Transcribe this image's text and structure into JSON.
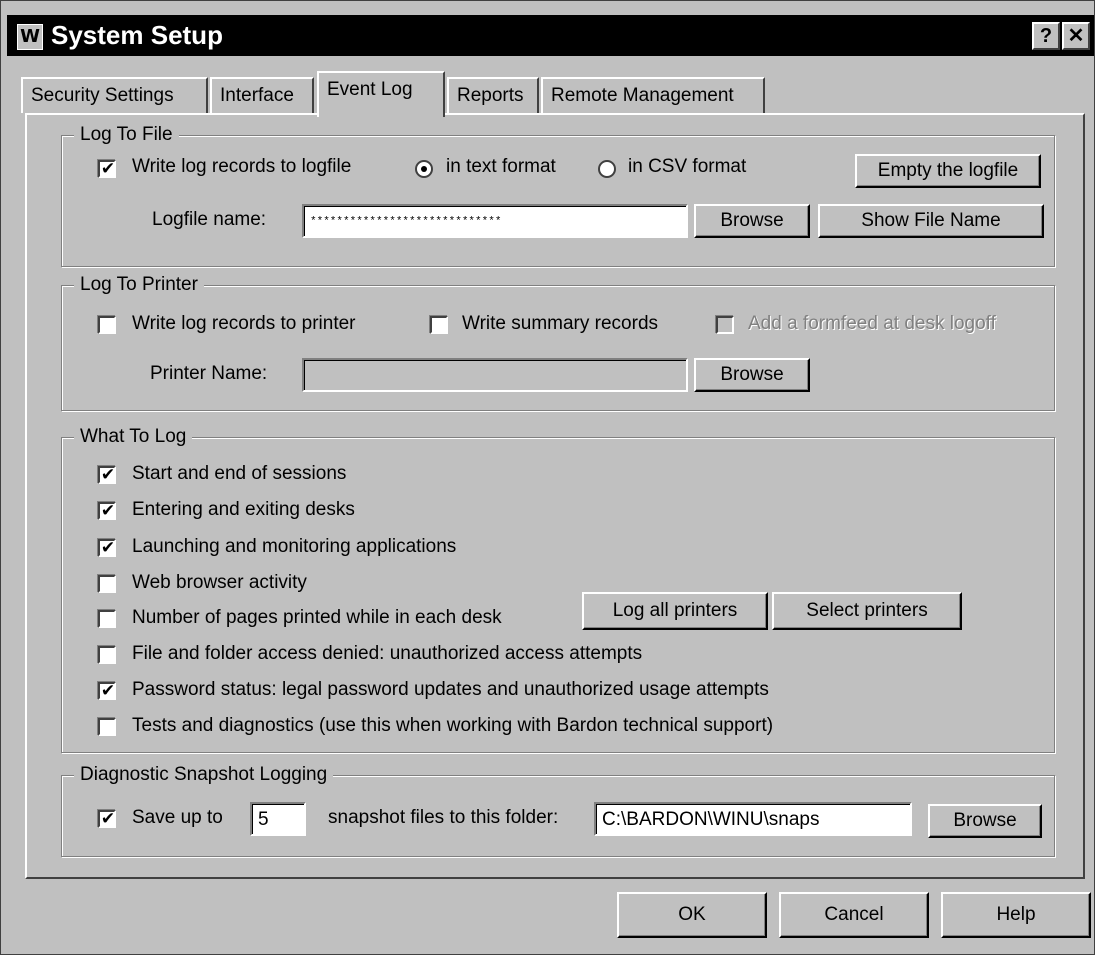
{
  "window": {
    "title": "System Setup",
    "help_button": "?",
    "close_button": "✕",
    "app_icon_letter": "W"
  },
  "tabs": [
    {
      "label": "Security Settings"
    },
    {
      "label": "Interface"
    },
    {
      "label": "Event Log"
    },
    {
      "label": "Reports"
    },
    {
      "label": "Remote Management"
    }
  ],
  "active_tab": "Event Log",
  "log_to_file": {
    "legend": "Log To File",
    "write_checkbox_label": "Write log records to logfile",
    "write_checked": true,
    "format_text_label": "in text format",
    "format_csv_label": "in CSV format",
    "selected_format": "text",
    "empty_button": "Empty the logfile",
    "logfile_name_label": "Logfile name:",
    "logfile_name_value": "*****************************",
    "browse_button": "Browse",
    "show_file_name_button": "Show File Name"
  },
  "log_to_printer": {
    "legend": "Log To Printer",
    "write_printer_label": "Write log records to printer",
    "write_printer_checked": false,
    "write_summary_label": "Write summary records",
    "write_summary_checked": false,
    "formfeed_label": "Add a formfeed at desk logoff",
    "formfeed_checked": false,
    "printer_name_label": "Printer Name:",
    "printer_name_value": "",
    "browse_button": "Browse"
  },
  "what_to_log": {
    "legend": "What To Log",
    "items": [
      {
        "label": "Start and end of sessions",
        "checked": true
      },
      {
        "label": "Entering and exiting desks",
        "checked": true
      },
      {
        "label": "Launching and monitoring applications",
        "checked": true
      },
      {
        "label": "Web browser activity",
        "checked": false
      },
      {
        "label": "Number of pages printed while in each desk",
        "checked": false
      },
      {
        "label": "File and  folder access denied: unauthorized access attempts",
        "checked": false
      },
      {
        "label": "Password status: legal password updates and unauthorized usage attempts",
        "checked": true
      },
      {
        "label": "Tests and diagnostics (use this when working with Bardon technical support)",
        "checked": false
      }
    ],
    "log_all_printers_button": "Log all printers",
    "select_printers_button": "Select printers"
  },
  "diagnostic": {
    "legend": "Diagnostic Snapshot Logging",
    "save_label": "Save up to",
    "save_checked": true,
    "count_value": "5",
    "folder_label": "snapshot files to this folder:",
    "folder_value": "C:\\BARDON\\WINU\\snaps",
    "browse_button": "Browse"
  },
  "footer": {
    "ok": "OK",
    "cancel": "Cancel",
    "help": "Help"
  },
  "check_mark": "✔"
}
